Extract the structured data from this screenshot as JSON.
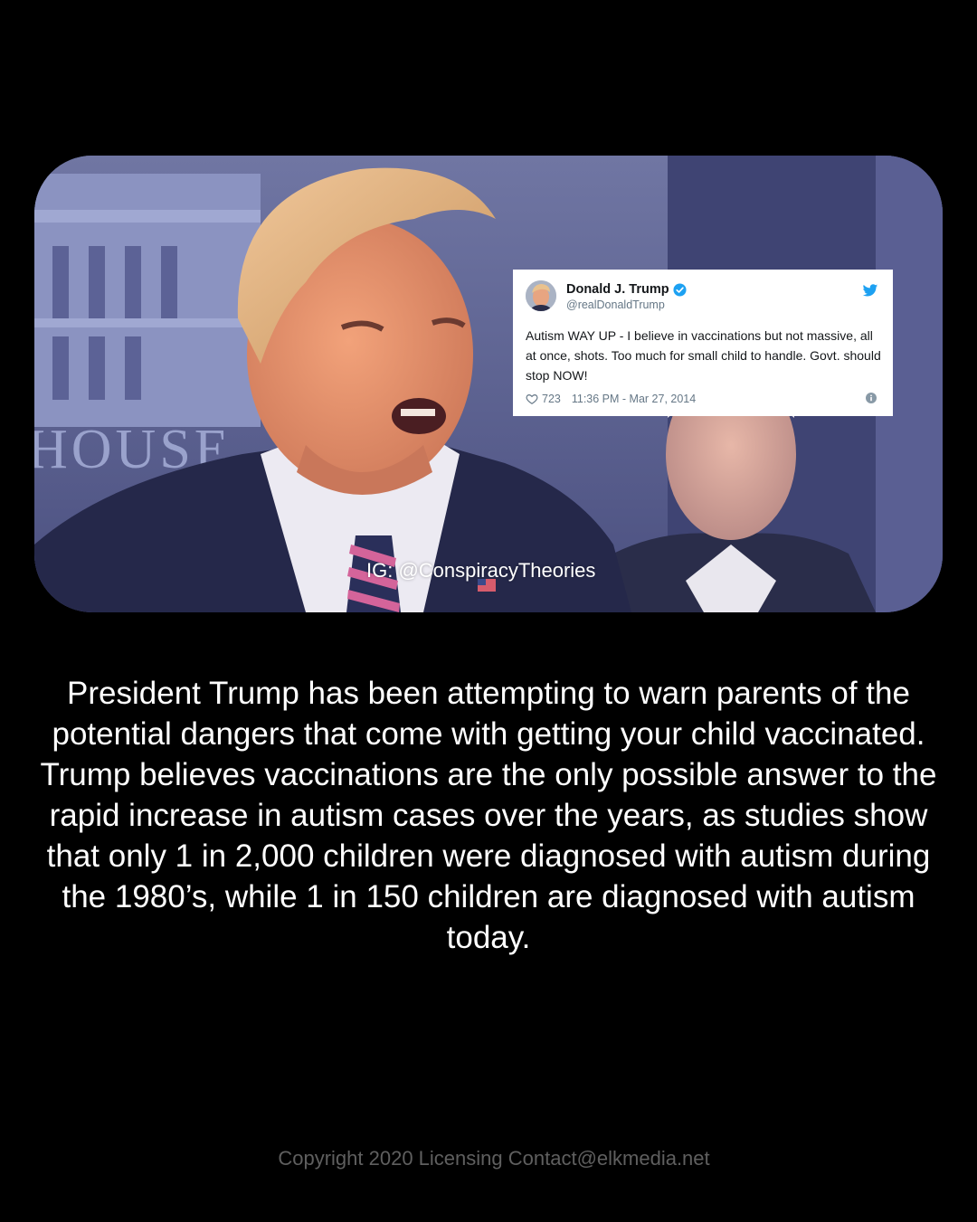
{
  "photo": {
    "background_sign_text": "HOUSE",
    "watermark": "IG: @ConspiracyTheories"
  },
  "tweet": {
    "author_name": "Donald J. Trump",
    "author_handle": "@realDonaldTrump",
    "text": "Autism WAY UP - I believe in vaccinations but not massive, all at once, shots. Too much for small child to handle. Govt. should stop NOW!",
    "likes": "723",
    "timestamp": "11:36 PM - Mar 27, 2014",
    "icons": [
      "verified-badge-icon",
      "twitter-bird-icon",
      "heart-icon",
      "info-icon"
    ],
    "colors": {
      "twitter_blue": "#1da1f2",
      "meta_gray": "#657786"
    }
  },
  "caption": {
    "text": "President Trump has been attempting to warn parents of the potential dangers that come with getting your child vaccinated. Trump believes vaccinations are the only possible answer to the rapid increase in autism cases over the years, as studies show that only 1 in 2,000 children were diagnosed with autism during the 1980’s, while 1 in 150 children are diagnosed with autism today."
  },
  "footer": {
    "text": "Copyright 2020 Licensing Contact@elkmedia.net"
  },
  "colors": {
    "page_background": "#000000",
    "caption_text": "#ffffff",
    "footer_text": "#5f5f5f"
  }
}
